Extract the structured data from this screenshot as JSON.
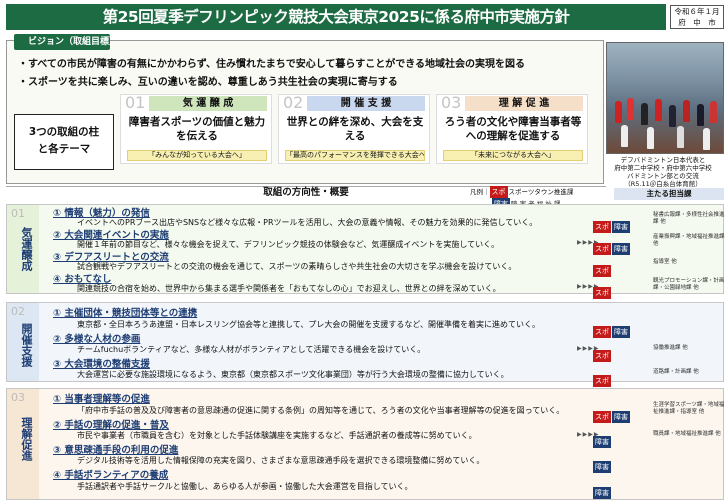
{
  "title": "第25回夏季デフリンピック競技大会東京2025に係る府中市実施方針",
  "date": {
    "line1": "令和６年１月",
    "line2": "府　中　市"
  },
  "vision": {
    "label": "ビジョン（取組目標）",
    "lines": [
      "・すべての市民が障害の有無にかかわらず、住み慣れたまちで安心して暮らすことができる地域社会の実現を図る",
      "・スポーツを共に楽しみ、互いの違いを認め、尊重しあう共生社会の実現に寄与する"
    ]
  },
  "three": {
    "line1": "3つの取組の柱",
    "line2": "と各テーマ"
  },
  "pillars": [
    {
      "num": "01",
      "head": "気 運 醸 成",
      "body": "障害者スポーツの価値と魅力を伝える",
      "foot": "「みんなが知っている大会へ」",
      "color": "#cfe6bd"
    },
    {
      "num": "02",
      "head": "開 催 支 援",
      "body": "世界との絆を深め、大会を支える",
      "foot": "「最高のパフォーマンスを発揮できる大会へ」",
      "color": "#c9d8ee"
    },
    {
      "num": "03",
      "head": "理 解 促 進",
      "body": "ろう者の文化や障害当事者等への理解を促進する",
      "foot": "「未来につながる大会へ」",
      "color": "#f6dfc9"
    }
  ],
  "photo_caption": [
    "デフバドミントン日本代表と",
    "府中第二中学校・府中第六中学校",
    "バドミントン部との交流",
    "（R5.11＠白糸台体育館）"
  ],
  "direction_label": "取組の方向性・概要",
  "legend": {
    "prefix": "凡例",
    "sp": "スポ",
    "sp_text": "スポーツタウン推進課",
    "sh": "障害",
    "sh_text": "障 害 者 福 祉 課"
  },
  "main_org_label": "主たる担当課",
  "sections": [
    {
      "num": "01",
      "label": "気運醸成",
      "items": [
        {
          "head": "① 情報（魅力）の発信",
          "body": "イベントへのPRブース出店やSNSなど様々な広報・PRツールを活用し、大会の意義や情報、その魅力を効果的に発信していく。",
          "org": "秘書広報課・多様性社会推進課 他"
        },
        {
          "head": "② 大会関連イベントの実施",
          "body": "開催１年前の節目など、様々な機会を捉えて、デフリンピック競技の体験会など、気運醸成イベントを実施していく。",
          "org": "産業振興課・地域福祉推進課 他"
        },
        {
          "head": "③ デフアスリートとの交流",
          "body": "試合観戦やデフアスリートとの交流の機会を通じて、スポーツの素晴らしさや共生社会の大切さを学ぶ機会を設けていく。",
          "org": "指導室 他"
        },
        {
          "head": "④ おもてなし",
          "body": "関連競技の合宿を始め、世界中から集まる選手や関係者を「おもてなしの心」でお迎えし、世界との絆を深めていく。",
          "org": "観光プロモーション課・計画課・公園緑地課 他"
        }
      ]
    },
    {
      "num": "02",
      "label": "開催支援",
      "items": [
        {
          "head": "① 主催団体・競技団体等との連携",
          "body": "東京都・全日本ろうあ連盟・日本レスリング協会等と連携して、プレ大会の開催を支援するなど、開催準備を着実に進めていく。",
          "org": ""
        },
        {
          "head": "② 多様な人材の参画",
          "body": "チームfuchuボランティアなど、多様な人材がボランティアとして活躍できる機会を設けていく。",
          "org": "協働推進課 他"
        },
        {
          "head": "③ 大会環境の整備支援",
          "body": "大会運営に必要な施設環境になるよう、東京都（東京都スポーツ文化事業団）等が行う大会環境の整備に協力していく。",
          "org": "道路課・計画課 他"
        }
      ]
    },
    {
      "num": "03",
      "label": "理解促進",
      "items": [
        {
          "head": "① 当事者理解等の促進",
          "body": "「府中市手話の普及及び障害者の意思疎通の促進に関する条例」の周知等を通じて、ろう者の文化や当事者理解等の促進を図っていく。",
          "org": "生涯学習スポーツ課・地域福祉推進課・指導室 他"
        },
        {
          "head": "② 手話の理解の促進・普及",
          "body": "市民や事業者（市職員を含む）を対象とした手話体験講座を実施するなど、手話通訳者の養成等に努めていく。",
          "org": "職員課・地域福祉推進課 他"
        },
        {
          "head": "③ 意思疎通手段の利用の促進",
          "body": "デジタル技術等を活用した情報保障の充実を図り、さまざまな意思疎通手段を選択できる環境整備に努めていく。",
          "org": ""
        },
        {
          "head": "④ 手話ボランティアの養成",
          "body": "手話通訳者や手話サークルと協働し、あらゆる人が参画・協働した大会運営を目指していく。",
          "org": ""
        }
      ]
    }
  ]
}
